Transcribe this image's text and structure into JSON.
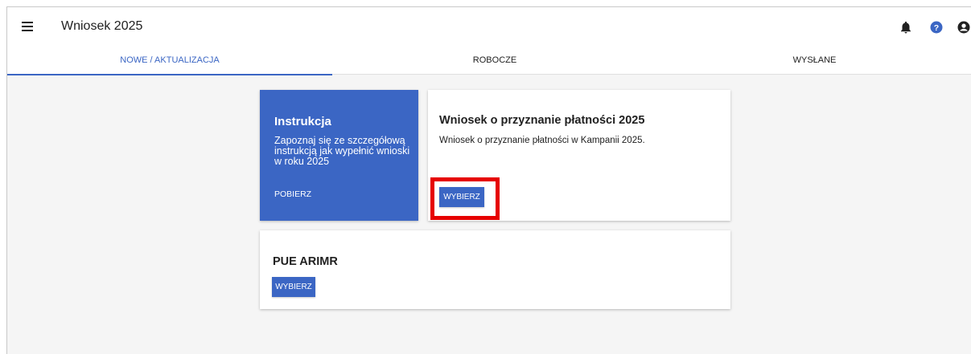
{
  "header": {
    "title": "Wniosek 2025",
    "icons": [
      "menu-icon",
      "bell-icon",
      "help-icon",
      "account-icon"
    ]
  },
  "tabs": [
    {
      "label": "NOWE / AKTUALIZACJA",
      "active": true
    },
    {
      "label": "ROBOCZE",
      "active": false
    },
    {
      "label": "WYSŁANE",
      "active": false
    }
  ],
  "cards": {
    "instrukcja": {
      "title": "Instrukcja",
      "text": "Zapoznaj się ze szczegółową instrukcją jak wypełnić wnioski w roku 2025",
      "link": "POBIERZ"
    },
    "wniosek": {
      "title": "Wniosek o przyznanie płatności 2025",
      "description": "Wniosek o przyznanie płatności w Kampanii 2025.",
      "button": "WYBIERZ"
    },
    "pue": {
      "title": "PUE ARIMR",
      "button": "WYBIERZ"
    }
  },
  "colors": {
    "accent": "#3b66c4",
    "highlight": "#e60000",
    "background": "#f5f5f5"
  }
}
